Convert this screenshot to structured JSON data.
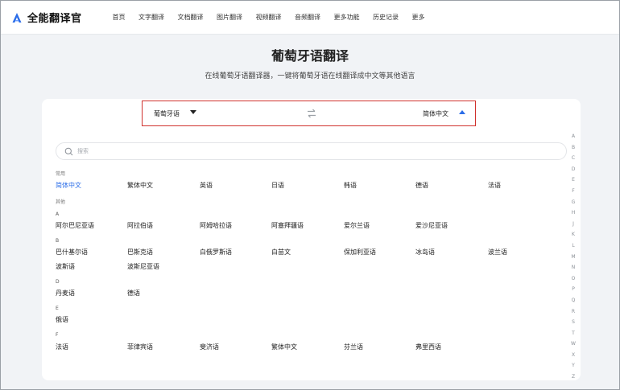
{
  "header": {
    "logo_text": "全能翻译官",
    "nav": [
      "首页",
      "文字翻译",
      "文档翻译",
      "图片翻译",
      "视频翻译",
      "音频翻译",
      "更多功能",
      "历史记录",
      "更多"
    ]
  },
  "page": {
    "title": "葡萄牙语翻译",
    "subtitle": "在线葡萄牙语翻译器，一键将葡萄牙语在线翻译成中文等其他语言"
  },
  "lang_bar": {
    "source": "葡萄牙语",
    "target": "简体中文"
  },
  "search": {
    "placeholder": "搜索"
  },
  "common": {
    "label": "常用",
    "items": [
      "简体中文",
      "繁体中文",
      "英语",
      "日语",
      "韩语",
      "德语",
      "法语"
    ]
  },
  "other_label": "其他",
  "groups": [
    {
      "letter": "A",
      "rows": [
        [
          "阿尔巴尼亚语",
          "阿拉伯语",
          "阿姆哈拉语",
          "阿塞拜疆语",
          "爱尔兰语",
          "爱沙尼亚语"
        ]
      ]
    },
    {
      "letter": "B",
      "rows": [
        [
          "巴什基尔语",
          "巴斯克语",
          "白俄罗斯语",
          "白苗文",
          "保加利亚语",
          "冰岛语",
          "波兰语"
        ],
        [
          "波斯语",
          "波斯尼亚语"
        ]
      ]
    },
    {
      "letter": "D",
      "rows": [
        [
          "丹麦语",
          "德语"
        ]
      ]
    },
    {
      "letter": "E",
      "rows": [
        [
          "俄语"
        ]
      ]
    },
    {
      "letter": "F",
      "rows": [
        [
          "法语",
          "菲律宾语",
          "斐济语",
          "繁体中文",
          "芬兰语",
          "弗里西语"
        ]
      ]
    }
  ],
  "alphabet": [
    "A",
    "B",
    "C",
    "D",
    "E",
    "F",
    "G",
    "H",
    "J",
    "K",
    "L",
    "M",
    "N",
    "O",
    "P",
    "Q",
    "R",
    "S",
    "T",
    "W",
    "X",
    "Y",
    "Z"
  ],
  "colors": {
    "accent": "#2b6de8",
    "highlight_border": "#d0312d"
  },
  "icons": {
    "logo": "logo-a-icon",
    "swap": "swap-arrows-icon",
    "search": "search-icon"
  }
}
